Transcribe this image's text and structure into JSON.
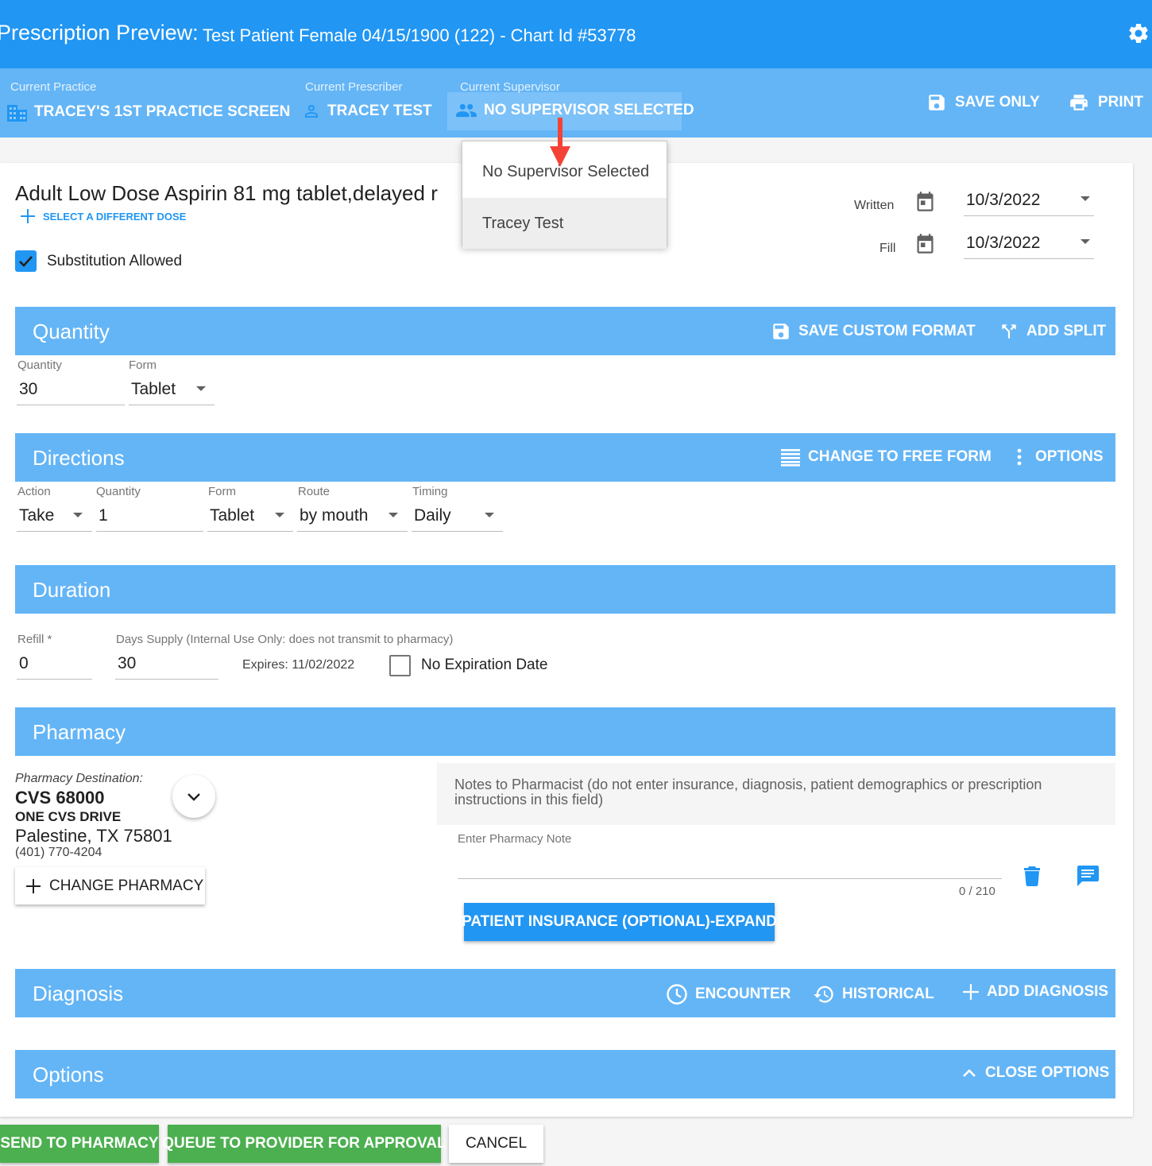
{
  "header": {
    "title": "Prescription Preview:",
    "patient": "Test Patient Female 04/15/1900 (122) - Chart Id #53778"
  },
  "context": {
    "practice_label": "Current Practice",
    "practice_value": "TRACEY'S 1ST PRACTICE SCREEN",
    "prescriber_label": "Current Prescriber",
    "prescriber_value": "TRACEY TEST",
    "supervisor_label": "Current Supervisor",
    "supervisor_value": "NO SUPERVISOR SELECTED",
    "save_only": "SAVE ONLY",
    "print": "PRINT"
  },
  "supervisor_menu": {
    "options": [
      "No Supervisor Selected",
      "Tracey Test"
    ],
    "highlighted": "Tracey Test"
  },
  "drug": {
    "name": "Adult Low Dose Aspirin 81 mg tablet,delayed r",
    "select_dose": "SELECT A DIFFERENT DOSE",
    "substitution_label": "Substitution Allowed",
    "substitution_checked": true,
    "written_label": "Written",
    "written_date": "10/3/2022",
    "fill_label": "Fill",
    "fill_date": "10/3/2022"
  },
  "quantity": {
    "title": "Quantity",
    "save_custom": "SAVE CUSTOM FORMAT",
    "add_split": "ADD SPLIT",
    "qty_label": "Quantity",
    "qty_value": "30",
    "form_label": "Form",
    "form_value": "Tablet"
  },
  "directions": {
    "title": "Directions",
    "free_form": "CHANGE TO FREE FORM",
    "options": "OPTIONS",
    "action_label": "Action",
    "action_value": "Take",
    "qty_label": "Quantity",
    "qty_value": "1",
    "form_label": "Form",
    "form_value": "Tablet",
    "route_label": "Route",
    "route_value": "by mouth",
    "timing_label": "Timing",
    "timing_value": "Daily"
  },
  "duration": {
    "title": "Duration",
    "refill_label": "Refill *",
    "refill_value": "0",
    "days_label": "Days Supply (Internal Use Only: does not transmit to pharmacy)",
    "days_value": "30",
    "expires": "Expires: 11/02/2022",
    "no_expiration": "No Expiration Date"
  },
  "pharmacy": {
    "title": "Pharmacy",
    "dest_label": "Pharmacy Destination:",
    "name": "CVS 68000",
    "street": "ONE CVS DRIVE",
    "city": "Palestine, TX 75801",
    "phone": "(401) 770-4204",
    "change": "CHANGE PHARMACY",
    "notes_info": "Notes to Pharmacist (do not enter insurance, diagnosis, patient demographics or prescription instructions in this field)",
    "note_placeholder": "Enter Pharmacy Note",
    "note_counter": "0 / 210",
    "insurance_btn": "PATIENT INSURANCE (OPTIONAL)-EXPAND"
  },
  "diagnosis": {
    "title": "Diagnosis",
    "encounter": "ENCOUNTER",
    "historical": "HISTORICAL",
    "add": "ADD DIAGNOSIS"
  },
  "options_section": {
    "title": "Options",
    "close": "CLOSE OPTIONS"
  },
  "footer": {
    "send": "SEND TO PHARMACY",
    "queue": "QUEUE TO PROVIDER FOR APPROVAL",
    "cancel": "CANCEL"
  },
  "colors": {
    "header_blue": "#2196f3",
    "section_blue": "#64b5f6",
    "action_green": "#4caf50",
    "arrow_red": "#f44336"
  }
}
